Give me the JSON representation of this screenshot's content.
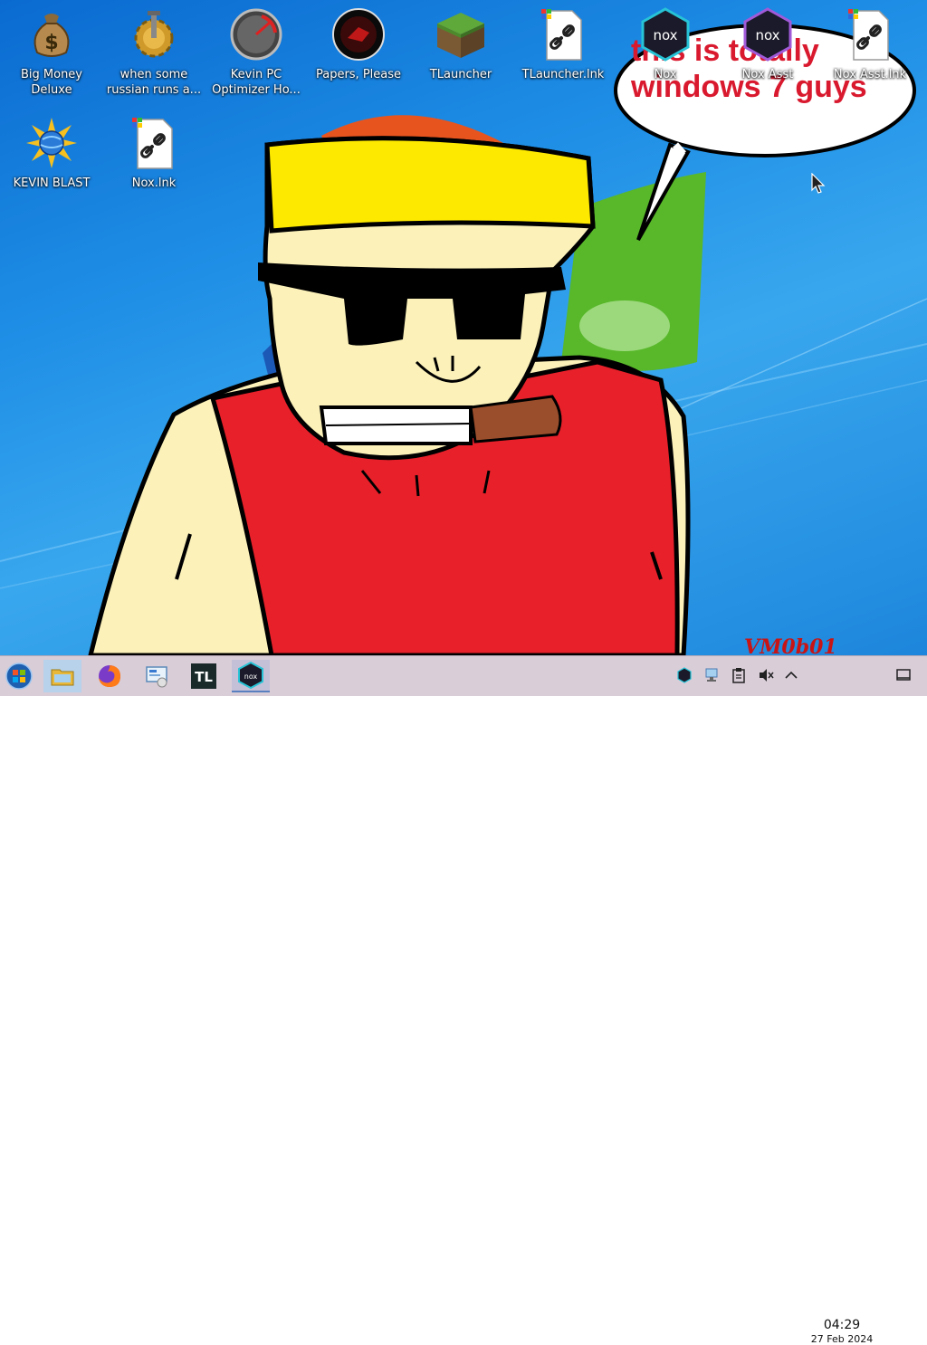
{
  "desktop": {
    "icons": [
      {
        "label": "Big Money Deluxe",
        "icon": "money-bag-icon"
      },
      {
        "label": "when some russian runs a...",
        "icon": "gear-icon"
      },
      {
        "label": "Kevin PC Optimizer Ho...",
        "icon": "speedometer-icon"
      },
      {
        "label": "Papers, Please",
        "icon": "papers-please-icon"
      },
      {
        "label": "TLauncher",
        "icon": "grass-block-icon"
      },
      {
        "label": "TLauncher.lnk",
        "icon": "shortcut-file-icon"
      },
      {
        "label": "Nox",
        "icon": "nox-icon"
      },
      {
        "label": "Nox Asst",
        "icon": "nox-icon"
      },
      {
        "label": "Nox Asst.lnk",
        "icon": "shortcut-file-icon"
      },
      {
        "label": "KEVIN BLAST",
        "icon": "globe-burst-icon"
      },
      {
        "label": "Nox.lnk",
        "icon": "shortcut-file-icon"
      }
    ],
    "wallpaper": {
      "speech_text": "this is totally windows 7 guys",
      "signature": "VM0b01"
    }
  },
  "taskbar": {
    "start": "windows-start-icon",
    "pinned": [
      "file-manager-icon",
      "firefox-icon",
      "control-panel-icon",
      "tlauncher-icon",
      "nox-icon"
    ],
    "tlauncher_text": "TL",
    "tray": [
      "nox-tray-icon",
      "network-icon",
      "clipboard-icon",
      "volume-muted-icon",
      "chevron-up-icon"
    ],
    "clock": {
      "time": "04:29",
      "date": "27 Feb 2024"
    },
    "show_desktop": "show-desktop-icon"
  },
  "colors": {
    "accent": "#5a7fc0",
    "taskbar": "#d9cdd8",
    "speech": "#d9192e"
  }
}
